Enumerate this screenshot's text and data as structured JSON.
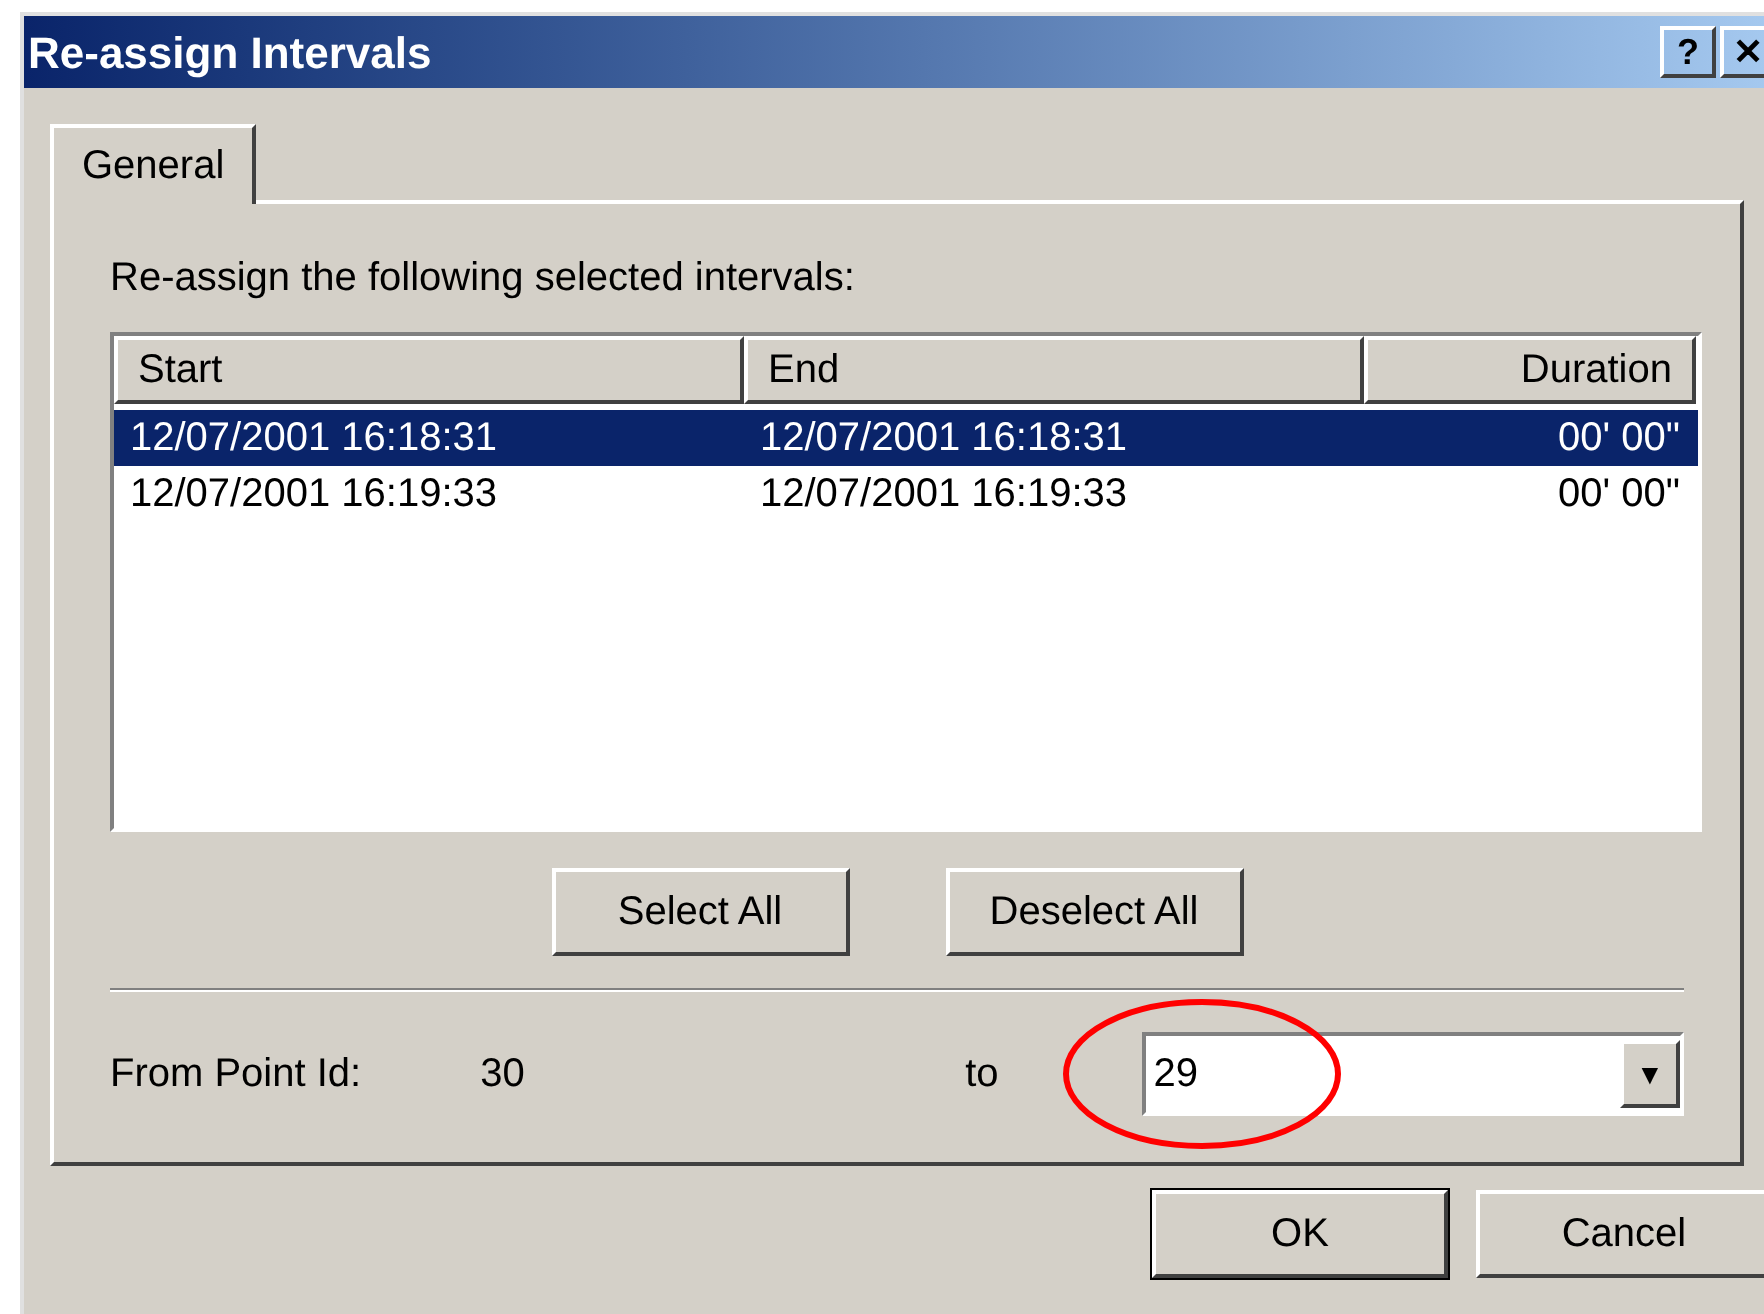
{
  "window": {
    "title": "Re-assign Intervals",
    "title_buttons": [
      "?",
      "✕"
    ]
  },
  "tabs": [
    {
      "label": "General",
      "selected": true
    }
  ],
  "instruction": "Re-assign the following selected intervals:",
  "table": {
    "columns": [
      {
        "label": "Start",
        "kind": "text"
      },
      {
        "label": "End",
        "kind": "text"
      },
      {
        "label": "Duration",
        "kind": "number"
      }
    ],
    "rows": [
      {
        "cells": [
          "12/07/2001 16:18:31",
          "12/07/2001 16:18:31",
          "00' 00\""
        ],
        "selected": true
      },
      {
        "cells": [
          "12/07/2001 16:19:33",
          "12/07/2001 16:19:33",
          "00' 00\""
        ],
        "selected": false
      }
    ]
  },
  "list_buttons": [
    "Select All",
    "Deselect All"
  ],
  "from": {
    "label": "From Point Id:",
    "value": "30",
    "to_label": "to",
    "to_field": {
      "value": "29",
      "dropdown": "▼"
    }
  },
  "annotations": [
    {
      "kind": "ellipse"
    }
  ],
  "buttons": [
    {
      "label": "OK",
      "default": true
    },
    {
      "label": "Cancel",
      "default": false
    }
  ]
}
